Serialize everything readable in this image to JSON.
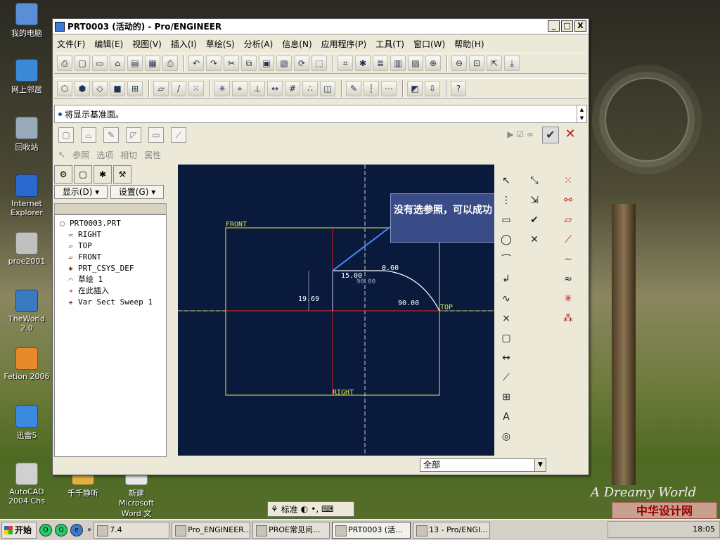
{
  "desktop": {
    "icons": [
      {
        "label": "我的电脑",
        "color": "#5a8fd8"
      },
      {
        "label": "网上邻居",
        "color": "#3a8ad8"
      },
      {
        "label": "回收站",
        "color": "#9ab"
      },
      {
        "label": "Internet Explorer",
        "color": "#2a6ad0"
      },
      {
        "label": "proe2001",
        "color": "#c0c0c0"
      },
      {
        "label": "TheWorld 2.0",
        "color": "#3a7ac0"
      },
      {
        "label": "Fetion 2006",
        "color": "#e88a2a"
      },
      {
        "label": "迅雷5",
        "color": "#3a8ae0"
      },
      {
        "label": "AutoCAD 2004 Chs",
        "color": "#d0d0d0"
      },
      {
        "label": "千千静听",
        "color": "#e0b040"
      },
      {
        "label": "新建 Microsoft Word 文档.doc",
        "color": "#e8e8e8"
      }
    ],
    "wallpaper_text": "A Dreamy World",
    "watermark": "中华设计网"
  },
  "window": {
    "title": "PRT0003 (活动的) - Pro/ENGINEER",
    "controls": {
      "minimize": "_",
      "maximize": "□",
      "close": "X"
    }
  },
  "menu": [
    "文件(F)",
    "编辑(E)",
    "视图(V)",
    "插入(I)",
    "草绘(S)",
    "分析(A)",
    "信息(N)",
    "应用程序(P)",
    "工具(T)",
    "窗口(W)",
    "帮助(H)"
  ],
  "toolbar1": [
    "page-setup",
    "new",
    "new-blank",
    "open",
    "save",
    "save-copy",
    "print",
    "undo",
    "redo",
    "cut",
    "copy",
    "paste",
    "paste-special",
    "regenerate",
    "select-box",
    "datum-plane",
    "spin-center",
    "layers",
    "saved-view",
    "repaint",
    "zoom-in",
    "zoom-out",
    "refit",
    "orient",
    "tool-order"
  ],
  "toolbar2": [
    "wireframe",
    "hidden",
    "no-hidden",
    "shaded",
    "model-tree",
    "datum-planes",
    "datum-axes",
    "datum-points",
    "csys",
    "datum-tags",
    "constraints",
    "dimensions",
    "grid",
    "vertices",
    "sketch-view",
    "sketch",
    "axis",
    "points",
    "intent",
    "manager",
    "help-what-is"
  ],
  "message": {
    "text": "将显示基准面。"
  },
  "dashboard": {
    "tabs": [
      "参照",
      "选项",
      "相切",
      "属性"
    ],
    "ok_label": "✔",
    "cancel_label": "✕",
    "right_icons": "▶ ☑ ∞"
  },
  "model_tree": {
    "tab_icons": [
      "⚙",
      "▢",
      "✱",
      "⚒"
    ],
    "show_label": "显示(D) ▾",
    "settings_label": "设置(G) ▾",
    "items": [
      {
        "label": "PRT0003.PRT",
        "icon": "▢"
      },
      {
        "label": "RIGHT",
        "icon": "▱"
      },
      {
        "label": "TOP",
        "icon": "▱"
      },
      {
        "label": "FRONT",
        "icon": "▱"
      },
      {
        "label": "PRT_CSYS_DEF",
        "icon": "✱"
      },
      {
        "label": "草绘 1",
        "icon": "⌒"
      },
      {
        "label": "在此插入",
        "icon": "➔"
      },
      {
        "label": "Var Sect Sweep 1",
        "icon": "⚹"
      }
    ]
  },
  "sketch": {
    "labels": {
      "front": "FRONT",
      "top": "TOP",
      "right": "RIGHT"
    },
    "dims": [
      "15.00",
      "0.60",
      "90.00",
      "19.69",
      "90.00"
    ],
    "callout": "没有选参照，可以成功"
  },
  "filter": {
    "value": "全部"
  },
  "ime": {
    "label": "标准"
  },
  "taskbar": {
    "start": "开始",
    "tasks": [
      {
        "label": "7.4",
        "active": false
      },
      {
        "label": "Pro_ENGINEER...",
        "active": false
      },
      {
        "label": "PROE常见问...",
        "active": false
      },
      {
        "label": "PRT0003 (活...",
        "active": true
      },
      {
        "label": "13 - Pro/ENGI...",
        "active": false
      }
    ],
    "clock": "18:05"
  }
}
